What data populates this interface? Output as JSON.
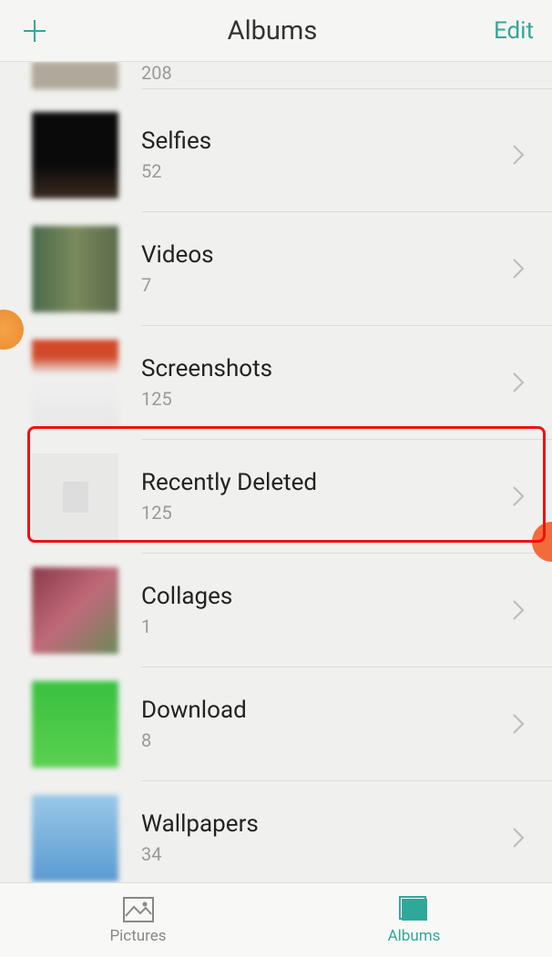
{
  "header": {
    "title": "Albums",
    "edit_label": "Edit"
  },
  "albums": [
    {
      "name": "",
      "count": "208",
      "thumb_class": "thumb-partial"
    },
    {
      "name": "Selfies",
      "count": "52",
      "thumb_class": "thumb-dark"
    },
    {
      "name": "Videos",
      "count": "7",
      "thumb_class": "thumb-people"
    },
    {
      "name": "Screenshots",
      "count": "125",
      "thumb_class": "thumb-screenshots"
    },
    {
      "name": "Recently Deleted",
      "count": "125",
      "thumb_class": "thumb-deleted",
      "highlighted": true
    },
    {
      "name": "Collages",
      "count": "1",
      "thumb_class": "thumb-collages"
    },
    {
      "name": "Download",
      "count": "8",
      "thumb_class": "thumb-download"
    },
    {
      "name": "Wallpapers",
      "count": "34",
      "thumb_class": "thumb-wallpapers"
    }
  ],
  "tabs": {
    "pictures": "Pictures",
    "albums": "Albums"
  },
  "colors": {
    "accent": "#2fa89a",
    "highlight_border": "#e11"
  }
}
